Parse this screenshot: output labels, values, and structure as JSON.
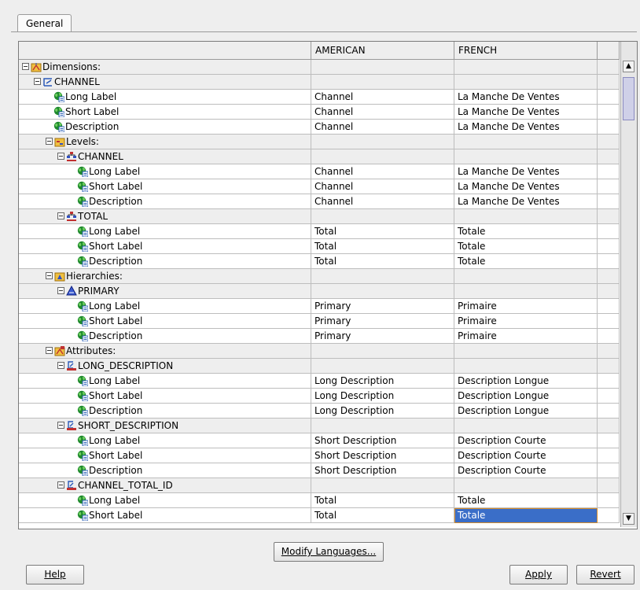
{
  "tabs": {
    "general": "General"
  },
  "columns": [
    "",
    "AMERICAN",
    "FRENCH"
  ],
  "rows": [
    {
      "indent": 0,
      "toggle": true,
      "icon": "dimensions-icon",
      "label": "Dimensions:",
      "american": "",
      "french": "",
      "group": true
    },
    {
      "indent": 1,
      "toggle": true,
      "icon": "dimension-icon",
      "label": "CHANNEL",
      "american": "",
      "french": "",
      "group": true
    },
    {
      "indent": 2,
      "toggle": false,
      "icon": "globe-icon",
      "label": "Long Label",
      "american": "Channel",
      "french": "La Manche De Ventes",
      "group": false
    },
    {
      "indent": 2,
      "toggle": false,
      "icon": "globe-icon",
      "label": "Short Label",
      "american": "Channel",
      "french": "La Manche De Ventes",
      "group": false
    },
    {
      "indent": 2,
      "toggle": false,
      "icon": "globe-icon",
      "label": "Description",
      "american": "Channel",
      "french": "La Manche De Ventes",
      "group": false
    },
    {
      "indent": 2,
      "toggle": true,
      "icon": "levels-icon",
      "label": "Levels:",
      "american": "",
      "french": "",
      "group": true
    },
    {
      "indent": 3,
      "toggle": true,
      "icon": "level-icon",
      "label": "CHANNEL",
      "american": "",
      "french": "",
      "group": true
    },
    {
      "indent": 4,
      "toggle": false,
      "icon": "globe-icon",
      "label": "Long Label",
      "american": "Channel",
      "french": "La Manche De Ventes",
      "group": false
    },
    {
      "indent": 4,
      "toggle": false,
      "icon": "globe-icon",
      "label": "Short Label",
      "american": "Channel",
      "french": "La Manche De Ventes",
      "group": false
    },
    {
      "indent": 4,
      "toggle": false,
      "icon": "globe-icon",
      "label": "Description",
      "american": "Channel",
      "french": "La Manche De Ventes",
      "group": false
    },
    {
      "indent": 3,
      "toggle": true,
      "icon": "level-icon",
      "label": "TOTAL",
      "american": "",
      "french": "",
      "group": true
    },
    {
      "indent": 4,
      "toggle": false,
      "icon": "globe-icon",
      "label": "Long Label",
      "american": "Total",
      "french": "Totale",
      "group": false
    },
    {
      "indent": 4,
      "toggle": false,
      "icon": "globe-icon",
      "label": "Short Label",
      "american": "Total",
      "french": "Totale",
      "group": false
    },
    {
      "indent": 4,
      "toggle": false,
      "icon": "globe-icon",
      "label": "Description",
      "american": "Total",
      "french": "Totale",
      "group": false
    },
    {
      "indent": 2,
      "toggle": true,
      "icon": "hierarchies-icon",
      "label": "Hierarchies:",
      "american": "",
      "french": "",
      "group": true
    },
    {
      "indent": 3,
      "toggle": true,
      "icon": "hierarchy-icon",
      "label": "PRIMARY",
      "american": "",
      "french": "",
      "group": true
    },
    {
      "indent": 4,
      "toggle": false,
      "icon": "globe-icon",
      "label": "Long Label",
      "american": "Primary",
      "french": "Primaire",
      "group": false
    },
    {
      "indent": 4,
      "toggle": false,
      "icon": "globe-icon",
      "label": "Short Label",
      "american": "Primary",
      "french": "Primaire",
      "group": false
    },
    {
      "indent": 4,
      "toggle": false,
      "icon": "globe-icon",
      "label": "Description",
      "american": "Primary",
      "french": "Primaire",
      "group": false
    },
    {
      "indent": 2,
      "toggle": true,
      "icon": "attributes-icon",
      "label": "Attributes:",
      "american": "",
      "french": "",
      "group": true
    },
    {
      "indent": 3,
      "toggle": true,
      "icon": "attribute-icon",
      "label": "LONG_DESCRIPTION",
      "american": "",
      "french": "",
      "group": true
    },
    {
      "indent": 4,
      "toggle": false,
      "icon": "globe-icon",
      "label": "Long Label",
      "american": "Long Description",
      "french": "Description Longue",
      "group": false
    },
    {
      "indent": 4,
      "toggle": false,
      "icon": "globe-icon",
      "label": "Short Label",
      "american": "Long Description",
      "french": "Description Longue",
      "group": false
    },
    {
      "indent": 4,
      "toggle": false,
      "icon": "globe-icon",
      "label": "Description",
      "american": "Long Description",
      "french": "Description Longue",
      "group": false
    },
    {
      "indent": 3,
      "toggle": true,
      "icon": "attribute-icon",
      "label": "SHORT_DESCRIPTION",
      "american": "",
      "french": "",
      "group": true
    },
    {
      "indent": 4,
      "toggle": false,
      "icon": "globe-icon",
      "label": "Long Label",
      "american": "Short Description",
      "french": "Description Courte",
      "group": false
    },
    {
      "indent": 4,
      "toggle": false,
      "icon": "globe-icon",
      "label": "Short Label",
      "american": "Short Description",
      "french": "Description Courte",
      "group": false
    },
    {
      "indent": 4,
      "toggle": false,
      "icon": "globe-icon",
      "label": "Description",
      "american": "Short Description",
      "french": "Description Courte",
      "group": false
    },
    {
      "indent": 3,
      "toggle": true,
      "icon": "attribute-icon",
      "label": "CHANNEL_TOTAL_ID",
      "american": "",
      "french": "",
      "group": true
    },
    {
      "indent": 4,
      "toggle": false,
      "icon": "globe-icon",
      "label": "Long Label",
      "american": "Total",
      "french": "Totale",
      "group": false
    },
    {
      "indent": 4,
      "toggle": false,
      "icon": "globe-icon",
      "label": "Short Label",
      "american": "Total",
      "french": "Totale",
      "group": false,
      "selected": true
    }
  ],
  "buttons": {
    "modify_languages": "Modify Languages...",
    "help": "Help",
    "apply": "Apply",
    "revert": "Revert"
  },
  "colors": {
    "selection": "#3a6ec8",
    "selection_border": "#d58b2a",
    "group_bg": "#eeeeee"
  }
}
